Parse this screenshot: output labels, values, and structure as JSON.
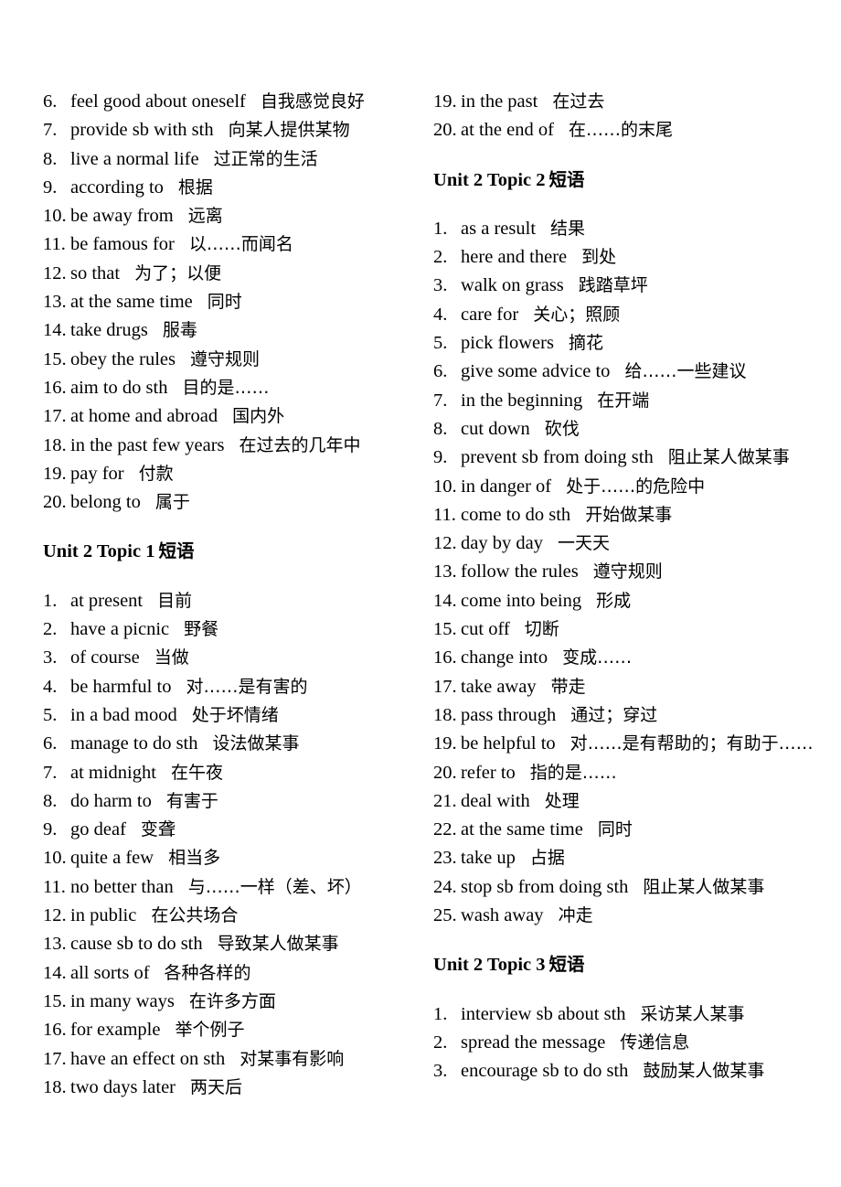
{
  "document": {
    "title": "English Phrases Vocabulary List",
    "background_color": "#ffffff",
    "text_color": "#000000"
  },
  "left_column": {
    "blocks": [
      {
        "type": "list",
        "start": 6,
        "items": [
          {
            "n": "6.",
            "en": "feel good about oneself",
            "zh": "自我感觉良好"
          },
          {
            "n": "7.",
            "en": "provide sb with sth",
            "zh": "向某人提供某物"
          },
          {
            "n": "8.",
            "en": "live a normal life",
            "zh": "过正常的生活"
          },
          {
            "n": "9.",
            "en": "according to",
            "zh": "根据"
          },
          {
            "n": "10.",
            "en": "be away from",
            "zh": "远离"
          },
          {
            "n": "11.",
            "en": "be famous for",
            "zh": "以……而闻名"
          },
          {
            "n": "12.",
            "en": "so that",
            "zh": "为了；以便"
          },
          {
            "n": "13.",
            "en": "at the same time",
            "zh": "同时"
          },
          {
            "n": "14.",
            "en": "take drugs",
            "zh": "服毒"
          },
          {
            "n": "15.",
            "en": "obey the rules",
            "zh": "遵守规则"
          },
          {
            "n": "16.",
            "en": "aim to do sth",
            "zh": "目的是……"
          },
          {
            "n": "17.",
            "en": "at home and abroad",
            "zh": "国内外"
          },
          {
            "n": "18.",
            "en": "in the past few years",
            "zh": "在过去的几年中"
          },
          {
            "n": "19.",
            "en": "pay for",
            "zh": "付款"
          },
          {
            "n": "20.",
            "en": "belong to",
            "zh": "属于"
          }
        ]
      },
      {
        "type": "heading",
        "en": "Unit 2 Topic 1",
        "zh": "短语"
      },
      {
        "type": "list",
        "start": 1,
        "items": [
          {
            "n": "1.",
            "en": "at present",
            "zh": "目前"
          },
          {
            "n": "2.",
            "en": "have a picnic",
            "zh": "野餐"
          },
          {
            "n": "3.",
            "en": "of course",
            "zh": "当做"
          },
          {
            "n": "4.",
            "en": "be harmful to",
            "zh": "对……是有害的"
          },
          {
            "n": "5.",
            "en": "in a bad mood",
            "zh": "处于坏情绪"
          },
          {
            "n": "6.",
            "en": "manage to do sth",
            "zh": "设法做某事"
          },
          {
            "n": "7.",
            "en": "at midnight",
            "zh": "在午夜"
          },
          {
            "n": "8.",
            "en": "do harm to",
            "zh": "有害于"
          },
          {
            "n": "9.",
            "en": "go deaf",
            "zh": "变聋"
          },
          {
            "n": "10.",
            "en": "quite a few",
            "zh": "相当多"
          },
          {
            "n": "11.",
            "en": "no better than",
            "zh": "与……一样（差、坏）"
          },
          {
            "n": "12.",
            "en": "in public",
            "zh": "在公共场合"
          },
          {
            "n": "13.",
            "en": "cause sb to do sth",
            "zh": "导致某人做某事"
          },
          {
            "n": "14.",
            "en": "all sorts of",
            "zh": "各种各样的"
          },
          {
            "n": "15.",
            "en": "in many ways",
            "zh": "在许多方面"
          },
          {
            "n": "16.",
            "en": "for example",
            "zh": "举个例子"
          },
          {
            "n": "17.",
            "en": "have an effect on sth",
            "zh": "对某事有影响"
          },
          {
            "n": "18.",
            "en": "two days later",
            "zh": "两天后"
          }
        ]
      }
    ]
  },
  "right_column": {
    "blocks": [
      {
        "type": "list",
        "start": 19,
        "items": [
          {
            "n": "19.",
            "en": "in the past",
            "zh": "在过去"
          },
          {
            "n": "20.",
            "en": "at the end of",
            "zh": "在……的末尾"
          }
        ]
      },
      {
        "type": "heading",
        "en": "Unit 2 Topic 2",
        "zh": "短语"
      },
      {
        "type": "list",
        "start": 1,
        "items": [
          {
            "n": "1.",
            "en": "as a result",
            "zh": "结果"
          },
          {
            "n": "2.",
            "en": "here and there",
            "zh": "到处"
          },
          {
            "n": "3.",
            "en": "walk on grass",
            "zh": "践踏草坪"
          },
          {
            "n": "4.",
            "en": "care for",
            "zh": "关心；照顾"
          },
          {
            "n": "5.",
            "en": "pick flowers",
            "zh": "摘花"
          },
          {
            "n": "6.",
            "en": "give some advice to",
            "zh": "给……一些建议"
          },
          {
            "n": "7.",
            "en": "in the beginning",
            "zh": "在开端"
          },
          {
            "n": "8.",
            "en": "cut down",
            "zh": "砍伐"
          },
          {
            "n": "9.",
            "en": "prevent sb from doing sth",
            "zh": "阻止某人做某事"
          },
          {
            "n": "10.",
            "en": "in danger of",
            "zh": "处于……的危险中"
          },
          {
            "n": "11.",
            "en": "come to do sth",
            "zh": "开始做某事"
          },
          {
            "n": "12.",
            "en": "day by day",
            "zh": "一天天"
          },
          {
            "n": "13.",
            "en": "follow the rules",
            "zh": "遵守规则"
          },
          {
            "n": "14.",
            "en": "come into being",
            "zh": "形成"
          },
          {
            "n": "15.",
            "en": "cut off",
            "zh": "切断"
          },
          {
            "n": "16.",
            "en": "change into",
            "zh": "变成……"
          },
          {
            "n": "17.",
            "en": "take away",
            "zh": "带走"
          },
          {
            "n": "18.",
            "en": "pass through",
            "zh": "通过；穿过"
          },
          {
            "n": "19.",
            "en": "be helpful to",
            "zh": "对……是有帮助的；有助于……",
            "wrap": true
          },
          {
            "n": "20.",
            "en": "refer to",
            "zh": "指的是……"
          },
          {
            "n": "21.",
            "en": "deal with",
            "zh": "处理"
          },
          {
            "n": "22.",
            "en": "at the same time",
            "zh": "同时"
          },
          {
            "n": "23.",
            "en": "take up",
            "zh": "占据"
          },
          {
            "n": "24.",
            "en": "stop sb from doing sth",
            "zh": "阻止某人做某事"
          },
          {
            "n": "25.",
            "en": "wash away",
            "zh": "冲走"
          }
        ]
      },
      {
        "type": "heading",
        "en": "Unit 2 Topic 3",
        "zh": "短语"
      },
      {
        "type": "list",
        "start": 1,
        "items": [
          {
            "n": "1.",
            "en": "interview sb about sth",
            "zh": "采访某人某事"
          },
          {
            "n": "2.",
            "en": "spread the message",
            "zh": "传递信息"
          },
          {
            "n": "3.",
            "en": "encourage sb to do sth",
            "zh": "鼓励某人做某事"
          }
        ]
      }
    ]
  }
}
